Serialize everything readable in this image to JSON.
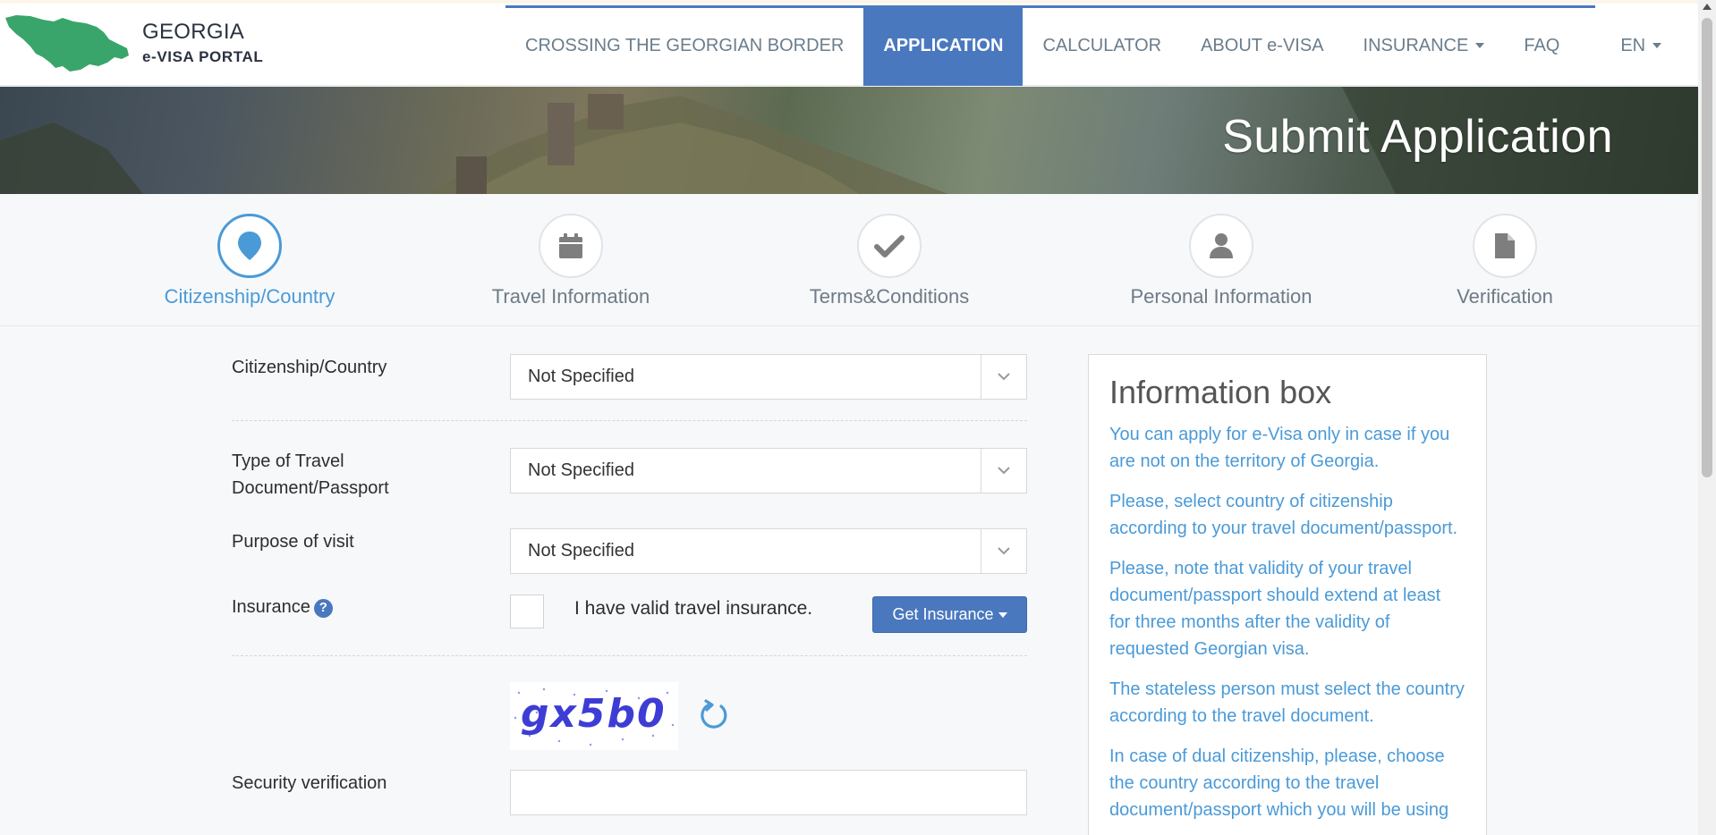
{
  "logo": {
    "title": "GEORGIA",
    "subtitle": "e-VISA PORTAL",
    "map_color": "#3aa56a"
  },
  "nav": {
    "items": [
      {
        "label": "CROSSING THE GEORGIAN BORDER"
      },
      {
        "label": "APPLICATION",
        "active": true
      },
      {
        "label": "CALCULATOR"
      },
      {
        "label": "ABOUT e-VISA"
      },
      {
        "label": "INSURANCE"
      },
      {
        "label": "FAQ"
      },
      {
        "label": "EN"
      }
    ],
    "accent": "#4a78be"
  },
  "banner": {
    "title": "Submit Application"
  },
  "steps": [
    {
      "label": "Citizenship/Country",
      "icon": "map-pin-icon",
      "active": true
    },
    {
      "label": "Travel Information",
      "icon": "calendar-icon"
    },
    {
      "label": "Terms&Conditions",
      "icon": "checkmark-icon"
    },
    {
      "label": "Personal Information",
      "icon": "person-icon"
    },
    {
      "label": "Verification",
      "icon": "document-icon"
    }
  ],
  "form": {
    "citizenship": {
      "label": "Citizenship/Country",
      "value": "Not Specified"
    },
    "document": {
      "label_line1": "Type of Travel",
      "label_line2": "Document/Passport",
      "value": "Not Specified"
    },
    "purpose": {
      "label": "Purpose of visit",
      "value": "Not Specified"
    },
    "insurance": {
      "label": "Insurance",
      "help": "?",
      "checkbox_label": "I have valid travel insurance.",
      "button_label": "Get Insurance"
    },
    "captcha": {
      "text": "gx5b0"
    },
    "security": {
      "label": "Security verification",
      "value": ""
    }
  },
  "info_box": {
    "title": "Information box",
    "paragraphs": [
      "You can apply for e-Visa only in case if you are not on the territory of Georgia.",
      "Please, select country of citizenship according to your travel document/passport.",
      "Please, note that validity of your travel document/passport should extend at least for three months after the validity of requested Georgian visa.",
      "The stateless person must select the country according to the travel document.",
      "In case of dual citizenship, please, choose the country according to the travel document/passport which you will be using"
    ],
    "text_color": "#4a9ad8"
  }
}
